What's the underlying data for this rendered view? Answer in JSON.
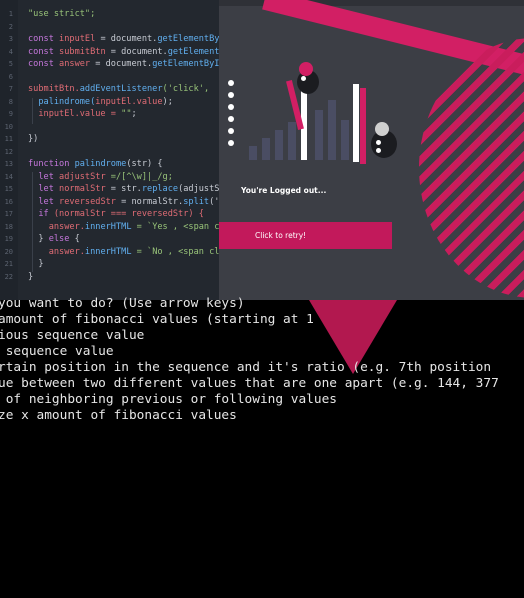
{
  "editor": {
    "lines": [
      {
        "n": "",
        "html_key": "l0"
      },
      {
        "n": "1",
        "html_key": "l1"
      },
      {
        "n": "2",
        "html_key": "l2"
      },
      {
        "n": "3",
        "html_key": "l3"
      },
      {
        "n": "4",
        "html_key": "l4"
      },
      {
        "n": "5",
        "html_key": "l5"
      },
      {
        "n": "6",
        "html_key": "l6"
      },
      {
        "n": "7",
        "html_key": "l7"
      },
      {
        "n": "8",
        "html_key": "l8"
      },
      {
        "n": "9",
        "html_key": "l9"
      },
      {
        "n": "10",
        "html_key": "l10"
      },
      {
        "n": "11",
        "html_key": "l11"
      },
      {
        "n": "12",
        "html_key": "l12"
      },
      {
        "n": "13",
        "html_key": "l13"
      },
      {
        "n": "14",
        "html_key": "l14"
      },
      {
        "n": "15",
        "html_key": "l15"
      },
      {
        "n": "16",
        "html_key": "l16"
      },
      {
        "n": "17",
        "html_key": "l17"
      },
      {
        "n": "18",
        "html_key": "l18"
      },
      {
        "n": "19",
        "html_key": "l19"
      },
      {
        "n": "20",
        "html_key": "l20"
      },
      {
        "n": "21",
        "html_key": "l21"
      },
      {
        "n": "22",
        "html_key": "l22"
      }
    ],
    "code": {
      "l1": "\"use strict\";",
      "l3a": "const ",
      "l3b": "inputEl",
      "l3c": " = document.",
      "l3d": "getElementById",
      "l4a": "const ",
      "l4b": "submitBtn",
      "l4c": " = document.",
      "l4d": "getElementB",
      "l5a": "const ",
      "l5b": "answer",
      "l5c": " = document.",
      "l5d": "getElementById",
      "l7a": "submitBtn.",
      "l7b": "addEventListener",
      "l7c": "('click', ",
      "l8a": "  palindrome(",
      "l8b": "inputEl.value",
      "l8c": ");",
      "l9a": "  inputEl.value = ",
      "l9b": "\"\"",
      "l9c": ";",
      "l11": "})",
      "l13a": "function ",
      "l13b": "palindrome",
      "l13c": "(str) {",
      "l14a": "  let ",
      "l14b": "adjustStr",
      "l14c": " =/[^\\w]|_/g;",
      "l15a": "  let ",
      "l15b": "normalStr",
      "l15c": " = str.",
      "l15d": "replace",
      "l15e": "(adjustSt",
      "l16a": "  let ",
      "l16b": "reversedStr",
      "l16c": " = normalStr.",
      "l16d": "split",
      "l16e": "(''",
      "l17a": "  if ",
      "l17b": "(normalStr === reversedStr) {",
      "l18a": "    answer.",
      "l18b": "innerHTML",
      "l18c": " = `Yes , <span cl",
      "l19a": "  } ",
      "l19b": "else",
      "l19c": " {",
      "l20a": "    answer.",
      "l20b": "innerHTML",
      "l20c": " = `No , <span cla",
      "l21": "  }",
      "l22": "}"
    }
  },
  "overlay": {
    "status_text": "You're Logged out...",
    "retry_label": "Click to retry!",
    "colors": {
      "accent": "#c2195b",
      "panel": "#3c3e45",
      "text": "#ffffff"
    }
  },
  "terminal": {
    "lines": [
      "you want to do? (Use arrow keys)",
      "amount of fibonacci values (starting at 1",
      "ious sequence value",
      " sequence value",
      "rtain position in the sequence and it's ratio (e.g. 7th position",
      "ue between two different values that are one apart (e.g. 144, 377",
      " of neighboring previous or following values",
      "ze x amount of fibonacci values"
    ]
  }
}
